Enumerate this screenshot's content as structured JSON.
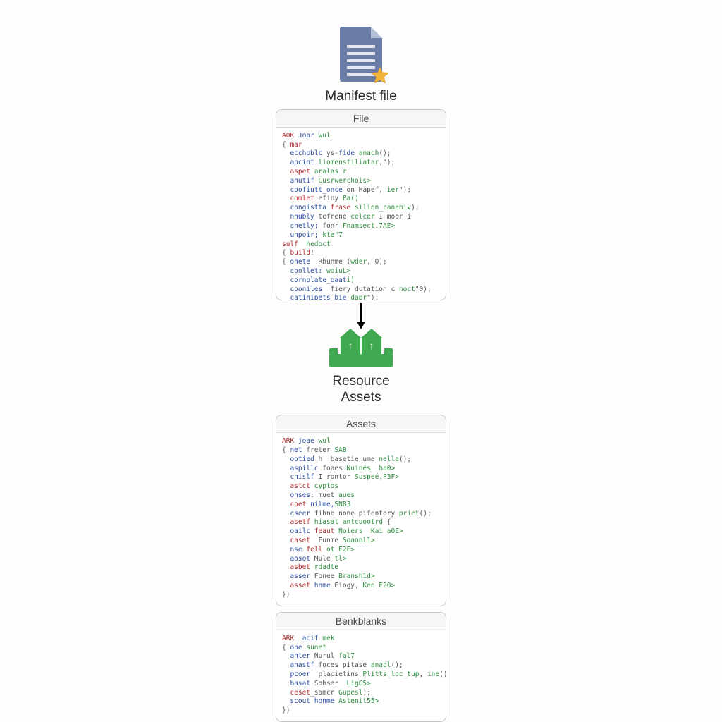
{
  "manifest": {
    "title_line1": "Manifest file",
    "panel_title": "File",
    "code": [
      [
        [
          "kw",
          "AOK"
        ],
        [
          "pu",
          " "
        ],
        [
          "bl",
          "Joar"
        ],
        [
          "pu",
          " "
        ],
        [
          "gr",
          "wul"
        ]
      ],
      [
        [
          "pu",
          "{ "
        ],
        [
          "kw",
          "mar"
        ]
      ],
      [
        [
          "pu",
          "  "
        ],
        [
          "bl",
          "ecchpblc"
        ],
        [
          "pu",
          " ys-"
        ],
        [
          "bl",
          "fide"
        ],
        [
          "pu",
          " "
        ],
        [
          "gr",
          "anach"
        ],
        [
          "pu",
          "();"
        ]
      ],
      [
        [
          "pu",
          "  "
        ],
        [
          "bl",
          "apcint"
        ],
        [
          "pu",
          " "
        ],
        [
          "gr",
          "liomenstiliatar"
        ],
        [
          "pu",
          ",\");"
        ]
      ],
      [
        [
          "pu",
          "  "
        ],
        [
          "kw",
          "aspet"
        ],
        [
          "pu",
          " "
        ],
        [
          "gr",
          "aralas r"
        ]
      ],
      [
        [
          "pu",
          "  "
        ],
        [
          "bl",
          "anutif"
        ],
        [
          "pu",
          " "
        ],
        [
          "gr",
          "Cusrwerchois>"
        ]
      ],
      [
        [
          "pu",
          "  "
        ],
        [
          "bl",
          "coofiutt_once"
        ],
        [
          "pu",
          " on Hapef, "
        ],
        [
          "gr",
          "ier"
        ],
        [
          "pu",
          "\");"
        ]
      ],
      [
        [
          "pu",
          "  "
        ],
        [
          "kw",
          "comlet"
        ],
        [
          "pu",
          " efiny "
        ],
        [
          "gr",
          "Pa()"
        ]
      ],
      [
        [
          "pu",
          "  "
        ],
        [
          "bl",
          "congistta"
        ],
        [
          "pu",
          " "
        ],
        [
          "kw",
          "frase"
        ],
        [
          "pu",
          " "
        ],
        [
          "gr",
          "silion_canehiv"
        ],
        [
          "pu",
          ");"
        ]
      ],
      [
        [
          "pu",
          "  "
        ],
        [
          "bl",
          "nnubly"
        ],
        [
          "pu",
          " tefrene "
        ],
        [
          "gr",
          "celcer"
        ],
        [
          "pu",
          " I moor i"
        ]
      ],
      [
        [
          "pu",
          "  "
        ],
        [
          "bl",
          "chetly;"
        ],
        [
          "pu",
          " fonr "
        ],
        [
          "gr",
          "Fnamsect.7AE>"
        ]
      ],
      [
        [
          "pu",
          "  "
        ],
        [
          "bl",
          "unpoir;"
        ],
        [
          "pu",
          " "
        ],
        [
          "gr",
          "kte\"7"
        ]
      ],
      [
        [
          "kw",
          "sulf"
        ],
        [
          "pu",
          "  "
        ],
        [
          "gr",
          "hedoct"
        ]
      ],
      [
        [
          "pu",
          "{ "
        ],
        [
          "kw",
          "build"
        ],
        [
          "pu",
          "!"
        ]
      ],
      [
        [
          "pu",
          "{ "
        ],
        [
          "bl",
          "onete"
        ],
        [
          "pu",
          "  Rhunme ("
        ],
        [
          "gr",
          "wder"
        ],
        [
          "pu",
          ", 0);"
        ]
      ],
      [
        [
          "pu",
          "  "
        ],
        [
          "bl",
          "coollet:"
        ],
        [
          "pu",
          " "
        ],
        [
          "gr",
          "woiuL>"
        ]
      ],
      [
        [
          "pu",
          "  "
        ],
        [
          "bl",
          "cornplate_oaat"
        ],
        [
          "gr",
          "i)"
        ]
      ],
      [
        [
          "pu",
          "  "
        ],
        [
          "bl",
          "cooniles"
        ],
        [
          "pu",
          "  fiery dutation c "
        ],
        [
          "gr",
          "noct"
        ],
        [
          "pu",
          "\"0);"
        ]
      ],
      [
        [
          "pu",
          "  "
        ],
        [
          "bl",
          "catinipets_bie"
        ],
        [
          "pu",
          " "
        ],
        [
          "gr",
          "dapr"
        ],
        [
          "pu",
          "\");"
        ]
      ],
      [
        [
          "pu",
          "}."
        ]
      ]
    ]
  },
  "assets": {
    "title_line1": "Resource",
    "title_line2": "Assets",
    "panel1_title": "Assets",
    "panel2_title": "Benkblanks",
    "code1": [
      [
        [
          "kw",
          "ARK"
        ],
        [
          "pu",
          " "
        ],
        [
          "bl",
          "joae"
        ],
        [
          "pu",
          " "
        ],
        [
          "gr",
          "wul"
        ]
      ],
      [
        [
          "pu",
          "{ "
        ],
        [
          "bl",
          "net"
        ],
        [
          "pu",
          " freter "
        ],
        [
          "gr",
          "SAB"
        ]
      ],
      [
        [
          "pu",
          "  "
        ],
        [
          "bl",
          "ootied"
        ],
        [
          "pu",
          " h  basetie ume "
        ],
        [
          "gr",
          "nella"
        ],
        [
          "pu",
          "();"
        ]
      ],
      [
        [
          "pu",
          "  "
        ],
        [
          "bl",
          "aspillc"
        ],
        [
          "pu",
          " foaes "
        ],
        [
          "gr",
          "Nuinés"
        ],
        [
          "pu",
          "  "
        ],
        [
          "gr",
          "ha0>"
        ]
      ],
      [
        [
          "pu",
          "  "
        ],
        [
          "bl",
          "cnislf"
        ],
        [
          "pu",
          " I rontor "
        ],
        [
          "gr",
          "Suspeé,P3F>"
        ]
      ],
      [
        [
          "pu",
          "  "
        ],
        [
          "kw",
          "astct"
        ],
        [
          "pu",
          " "
        ],
        [
          "gr",
          "cyptos"
        ]
      ],
      [
        [
          "pu",
          "  "
        ],
        [
          "bl",
          "onses:"
        ],
        [
          "pu",
          " muet "
        ],
        [
          "gr",
          "aues"
        ]
      ],
      [
        [
          "pu",
          "  "
        ],
        [
          "kw",
          "coet"
        ],
        [
          "pu",
          " "
        ],
        [
          "bl",
          "nilme,"
        ],
        [
          "gr",
          "SNB3"
        ]
      ],
      [
        [
          "pu",
          "  "
        ],
        [
          "bl",
          "cseer"
        ],
        [
          "pu",
          " fibne none pifentory "
        ],
        [
          "gr",
          "priet"
        ],
        [
          "pu",
          "();"
        ]
      ],
      [
        [
          "pu",
          "  "
        ],
        [
          "kw",
          "asetf"
        ],
        [
          "pu",
          " "
        ],
        [
          "gr",
          "hiasat antcuootrd"
        ],
        [
          "pu",
          " {"
        ]
      ],
      [
        [
          "pu",
          "  "
        ],
        [
          "bl",
          "oailc"
        ],
        [
          "pu",
          " "
        ],
        [
          "kw",
          "feaut"
        ],
        [
          "pu",
          " "
        ],
        [
          "gr",
          "Noiers"
        ],
        [
          "pu",
          "  "
        ],
        [
          "gr",
          "Kai a0E>"
        ]
      ],
      [
        [
          "pu",
          "  "
        ],
        [
          "kw",
          "caset"
        ],
        [
          "pu",
          "  Funme "
        ],
        [
          "gr",
          "Soaonl1>"
        ]
      ],
      [
        [
          "pu",
          "  "
        ],
        [
          "bl",
          "nse"
        ],
        [
          "pu",
          " "
        ],
        [
          "kw",
          "fell"
        ],
        [
          "pu",
          " "
        ],
        [
          "gr",
          "ot E2E>"
        ]
      ],
      [
        [
          "pu",
          "  "
        ],
        [
          "bl",
          "aosot"
        ],
        [
          "pu",
          " Mule "
        ],
        [
          "gr",
          "tl>"
        ]
      ],
      [
        [
          "pu",
          "  "
        ],
        [
          "kw",
          "asbet"
        ],
        [
          "pu",
          " "
        ],
        [
          "gr",
          "rdadte"
        ]
      ],
      [
        [
          "pu",
          "  "
        ],
        [
          "bl",
          "asser"
        ],
        [
          "pu",
          " Fonee "
        ],
        [
          "gr",
          "Bransh1d>"
        ]
      ],
      [
        [
          "pu",
          "  "
        ],
        [
          "kw",
          "asset"
        ],
        [
          "pu",
          " "
        ],
        [
          "bl",
          "hnme"
        ],
        [
          "pu",
          " Eiogy, "
        ],
        [
          "gr",
          "Ken E20>"
        ]
      ],
      [
        [
          "pu",
          "})"
        ]
      ]
    ],
    "code2": [
      [
        [
          "kw",
          "ARK"
        ],
        [
          "pu",
          "  "
        ],
        [
          "bl",
          "acif"
        ],
        [
          "pu",
          " "
        ],
        [
          "gr",
          "mek"
        ]
      ],
      [
        [
          "pu",
          "{ "
        ],
        [
          "bl",
          "obe"
        ],
        [
          "pu",
          " "
        ],
        [
          "gr",
          "sunet"
        ]
      ],
      [
        [
          "pu",
          "  "
        ],
        [
          "bl",
          "ahter"
        ],
        [
          "pu",
          " Nurul "
        ],
        [
          "gr",
          "fal7"
        ]
      ],
      [
        [
          "pu",
          "  "
        ],
        [
          "bl",
          "anastf"
        ],
        [
          "pu",
          " foces pitase "
        ],
        [
          "gr",
          "anabl"
        ],
        [
          "pu",
          "();"
        ]
      ],
      [
        [
          "pu",
          "  "
        ],
        [
          "bl",
          "pcoer"
        ],
        [
          "pu",
          "  placietins "
        ],
        [
          "gr",
          "Plitts_loc_tup"
        ],
        [
          "pu",
          ", "
        ],
        [
          "gr",
          "ine"
        ],
        [
          "pu",
          "();"
        ]
      ],
      [
        [
          "pu",
          "  "
        ],
        [
          "bl",
          "basat"
        ],
        [
          "pu",
          " Sobser  "
        ],
        [
          "gr",
          "LigG5>"
        ]
      ],
      [
        [
          "pu",
          "  "
        ],
        [
          "kw",
          "ceset"
        ],
        [
          "pu",
          "_samcr "
        ],
        [
          "gr",
          "Gupesl"
        ],
        [
          "pu",
          ");"
        ]
      ],
      [
        [
          "pu",
          "  "
        ],
        [
          "bl",
          "scout"
        ],
        [
          "pu",
          " "
        ],
        [
          "bl",
          "honme"
        ],
        [
          "pu",
          " "
        ],
        [
          "gr",
          "Astenit55>"
        ]
      ],
      [
        [
          "pu",
          "})"
        ]
      ]
    ]
  }
}
